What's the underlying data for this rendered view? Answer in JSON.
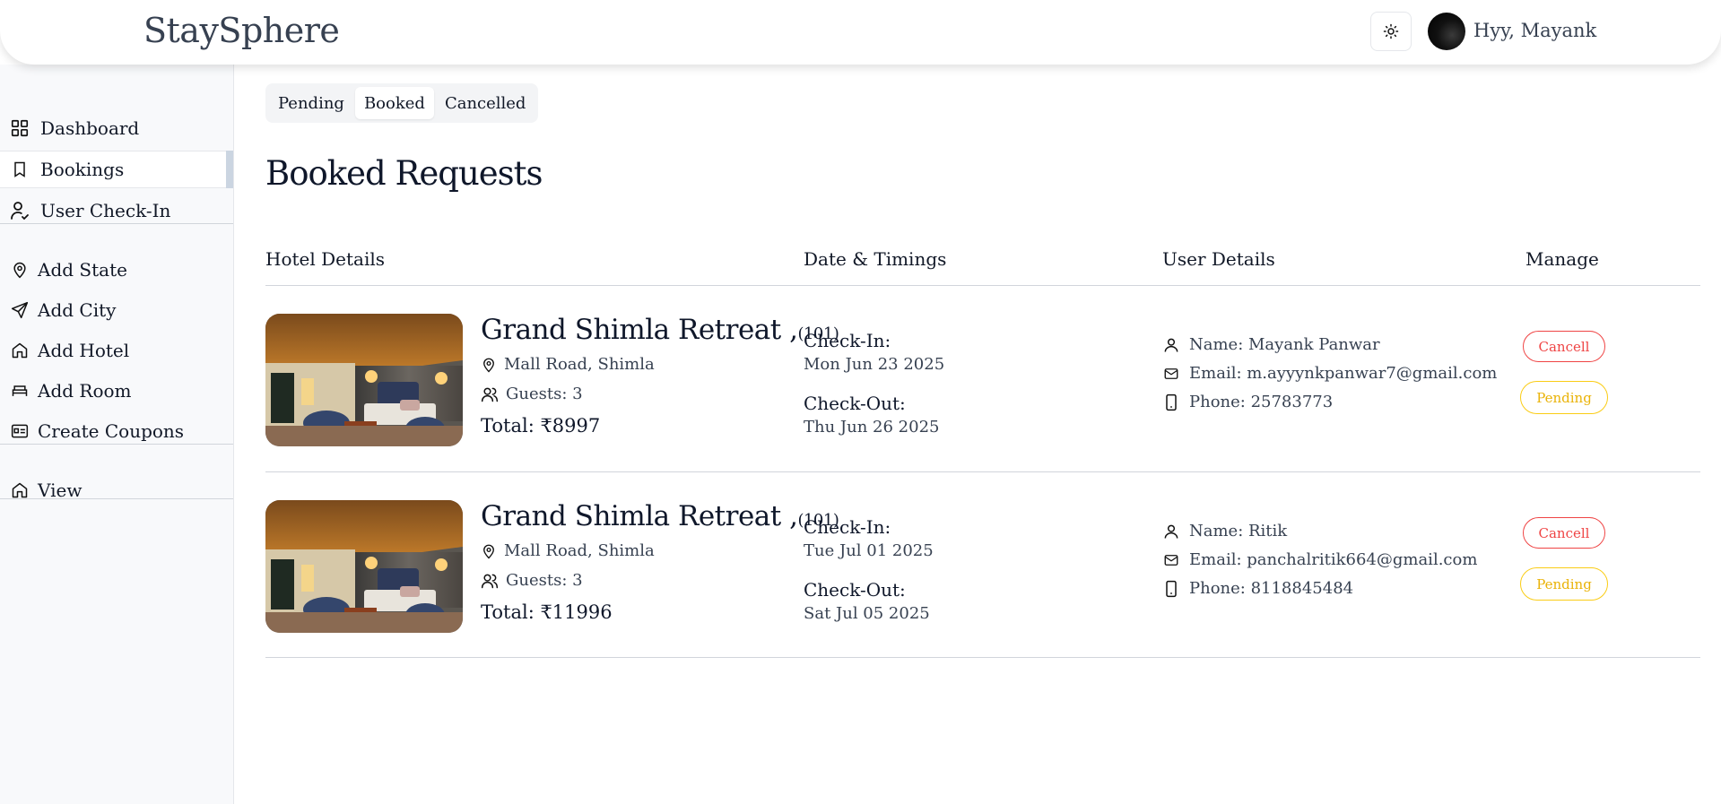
{
  "header": {
    "brand": "StaySphere",
    "greeting": "Hyy, Mayank"
  },
  "sidebar": {
    "items": [
      {
        "label": "Dashboard",
        "icon": "grid-icon"
      },
      {
        "label": "Bookings",
        "icon": "bookmark-icon",
        "active": true
      },
      {
        "label": "User Check-In",
        "icon": "user-check-icon"
      },
      {
        "label": "Add State",
        "icon": "map-pin-icon"
      },
      {
        "label": "Add City",
        "icon": "send-icon"
      },
      {
        "label": "Add Hotel",
        "icon": "home-icon"
      },
      {
        "label": "Add Room",
        "icon": "bed-icon"
      },
      {
        "label": "Create Coupons",
        "icon": "id-card-icon"
      },
      {
        "label": "View",
        "icon": "home-icon"
      }
    ]
  },
  "tabs": [
    {
      "label": "Pending",
      "active": false
    },
    {
      "label": "Booked",
      "active": true
    },
    {
      "label": "Cancelled",
      "active": false
    }
  ],
  "main": {
    "title": "Booked Requests",
    "columns": [
      "Hotel Details",
      "Date & Timings",
      "User Details",
      "Manage"
    ]
  },
  "bookings": [
    {
      "hotel": "Grand Shimla Retreat ,",
      "room": "(101)",
      "location": "Mall Road, Shimla",
      "guests": "Guests: 3",
      "total": "Total: ₹8997",
      "checkin_label": "Check-In:",
      "checkin": "Mon Jun 23 2025",
      "checkout_label": "Check-Out:",
      "checkout": "Thu Jun 26 2025",
      "name": "Name: Mayank Panwar",
      "email": "Email: m.ayyynkpanwar7@gmail.com",
      "phone": "Phone: 25783773",
      "cancel_label": "Cancell",
      "status_label": "Pending"
    },
    {
      "hotel": "Grand Shimla Retreat ,",
      "room": "(101)",
      "location": "Mall Road, Shimla",
      "guests": "Guests: 3",
      "total": "Total: ₹11996",
      "checkin_label": "Check-In:",
      "checkin": "Tue Jul 01 2025",
      "checkout_label": "Check-Out:",
      "checkout": "Sat Jul 05 2025",
      "name": "Name: Ritik",
      "email": "Email: panchalritik664@gmail.com",
      "phone": "Phone: 8118845484",
      "cancel_label": "Cancell",
      "status_label": "Pending"
    }
  ],
  "colors": {
    "cancel": "#ef4444",
    "pending": "#eab308",
    "sidebar_bg": "#f8f9fb"
  }
}
